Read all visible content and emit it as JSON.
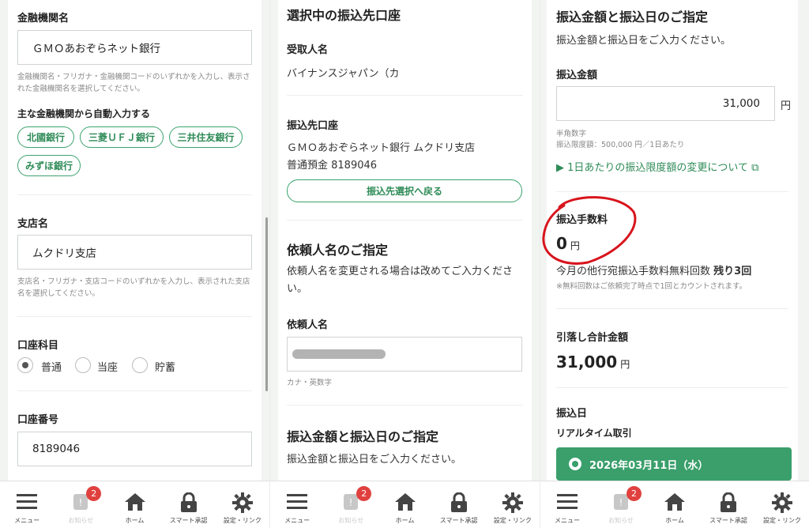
{
  "panel1": {
    "bank_label": "金融機関名",
    "bank_value": "ＧＭＯあおぞらネット銀行",
    "bank_help": "金融機関名・フリガナ・金融機関コードのいずれかを入力し、表示された金融機関名を選択してください。",
    "auto_fill_label": "主な金融機関から自動入力する",
    "banks": [
      "北國銀行",
      "三菱ＵＦＪ銀行",
      "三井住友銀行",
      "みずほ銀行"
    ],
    "branch_label": "支店名",
    "branch_value": "ムクドリ支店",
    "branch_help": "支店名・フリガナ・支店コードのいずれかを入力し、表示された支店名を選択してください。",
    "account_type_label": "口座科目",
    "account_types": [
      "普通",
      "当座",
      "貯蓄"
    ],
    "account_type_selected": "普通",
    "account_no_label": "口座番号",
    "account_no_value": "8189046"
  },
  "panel2": {
    "selected_title": "選択中の振込先口座",
    "recipient_label": "受取人名",
    "recipient_value": "バイナンスジャパン（カ",
    "dest_label": "振込先口座",
    "dest_line1": "ＧＭＯあおぞらネット銀行 ムクドリ支店",
    "dest_line2": "普通預金 8189046",
    "back_button": "振込先選択へ戻る",
    "requester_title": "依頼人名のご指定",
    "requester_desc": "依頼人名を変更される場合は改めてご入力ください。",
    "requester_label": "依頼人名",
    "requester_hint": "カナ・英数字",
    "amount_title": "振込金額と振込日のご指定",
    "amount_desc": "振込金額と振込日をご入力ください。"
  },
  "panel3": {
    "amount_title": "振込金額と振込日のご指定",
    "amount_desc": "振込金額と振込日をご入力ください。",
    "amount_label": "振込金額",
    "amount_value": "31,000",
    "yen": "円",
    "amount_hint1": "半角数字",
    "amount_hint2": "振込限度額：500,000 円／1日あたり",
    "limit_link": "▶ 1日あたりの振込限度額の変更について",
    "fee_label": "振込手数料",
    "fee_value": "0",
    "free_count_text": "今月の他行宛振込手数料無料回数",
    "free_count_remaining": "残り3回",
    "free_note": "※無料回数はご依頼完了時点で1回とカウントされます。",
    "total_label": "引落し合計金額",
    "total_value": "31,000",
    "date_label": "振込日",
    "realtime_label": "リアルタイム取引",
    "date_value": "2026年03月11日（水）"
  },
  "tabbar": {
    "items": [
      "メニュー",
      "お知らせ",
      "ホーム",
      "スマート承認",
      "設定・リンク"
    ],
    "badge": "2"
  },
  "colors": {
    "accent": "#3a9f6b",
    "circle": "#d8141c",
    "badge": "#e0413e"
  }
}
